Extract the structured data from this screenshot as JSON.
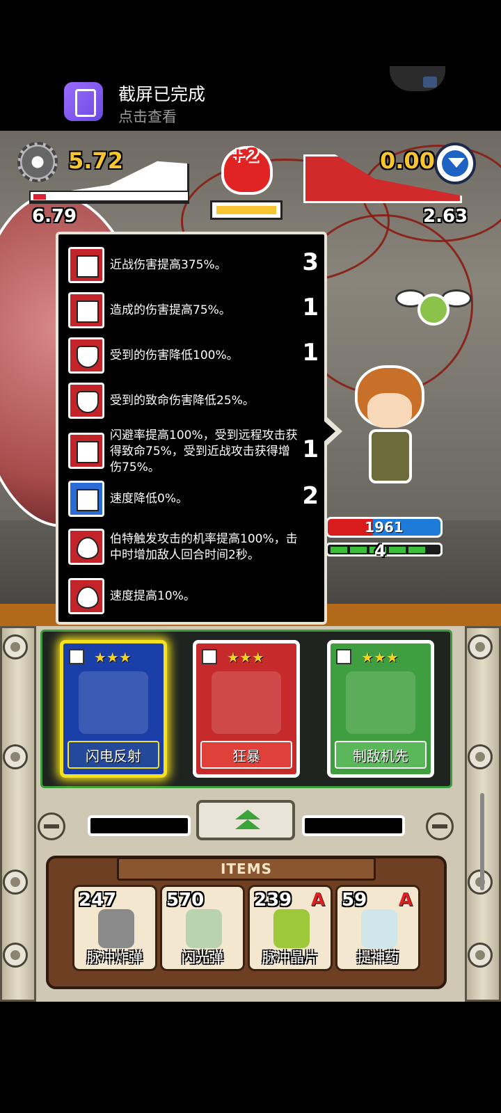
{
  "notification": {
    "title": "截屏已完成",
    "subtitle": "点击查看",
    "icon": "screenshot-icon"
  },
  "hud": {
    "left_value": "5.72",
    "left_sub_value": "6.79",
    "skull_value": "+2",
    "right_value": "0.00",
    "right_sub_value": "2.63",
    "settings_icon": "gear-icon",
    "toggle_icon": "chevron-down-icon"
  },
  "buffs": [
    {
      "icon": "fist-icon",
      "text": "近战伤害提高375%。",
      "count": "3"
    },
    {
      "icon": "fist-icon",
      "text": "造成的伤害提高75%。",
      "count": "1"
    },
    {
      "icon": "shield-icon",
      "text": "受到的伤害降低100%。",
      "count": "1"
    },
    {
      "icon": "shield-icon",
      "text": "受到的致命伤害降低25%。",
      "count": ""
    },
    {
      "icon": "dodge-icon",
      "text": "闪避率提高100%，受到远程攻击获得致命75%，受到近战攻击获得增伤75%。",
      "count": "1"
    },
    {
      "icon": "boot-icon",
      "text": "速度降低0%。",
      "count": "2"
    },
    {
      "icon": "drop-icon",
      "text": "伯特触发攻击的机率提高100%，击中时增加敌人回合时间2秒。",
      "count": ""
    },
    {
      "icon": "drop-icon",
      "text": "速度提高10%。",
      "count": ""
    }
  ],
  "hero": {
    "hp": "1961",
    "energy": "4"
  },
  "cards": [
    {
      "name": "闪电反射",
      "color": "blue",
      "stars": "★★★"
    },
    {
      "name": "狂暴",
      "color": "red",
      "stars": "★★★"
    },
    {
      "name": "制敌机先",
      "color": "green",
      "stars": "★★★"
    }
  ],
  "items_header": "ITEMS",
  "items": [
    {
      "count": "247",
      "name": "脉冲炸弹",
      "badge": ""
    },
    {
      "count": "570",
      "name": "闪光弹",
      "badge": ""
    },
    {
      "count": "239",
      "name": "脉冲晶片",
      "badge": "A"
    },
    {
      "count": "59",
      "name": "提神药",
      "badge": "A"
    }
  ]
}
